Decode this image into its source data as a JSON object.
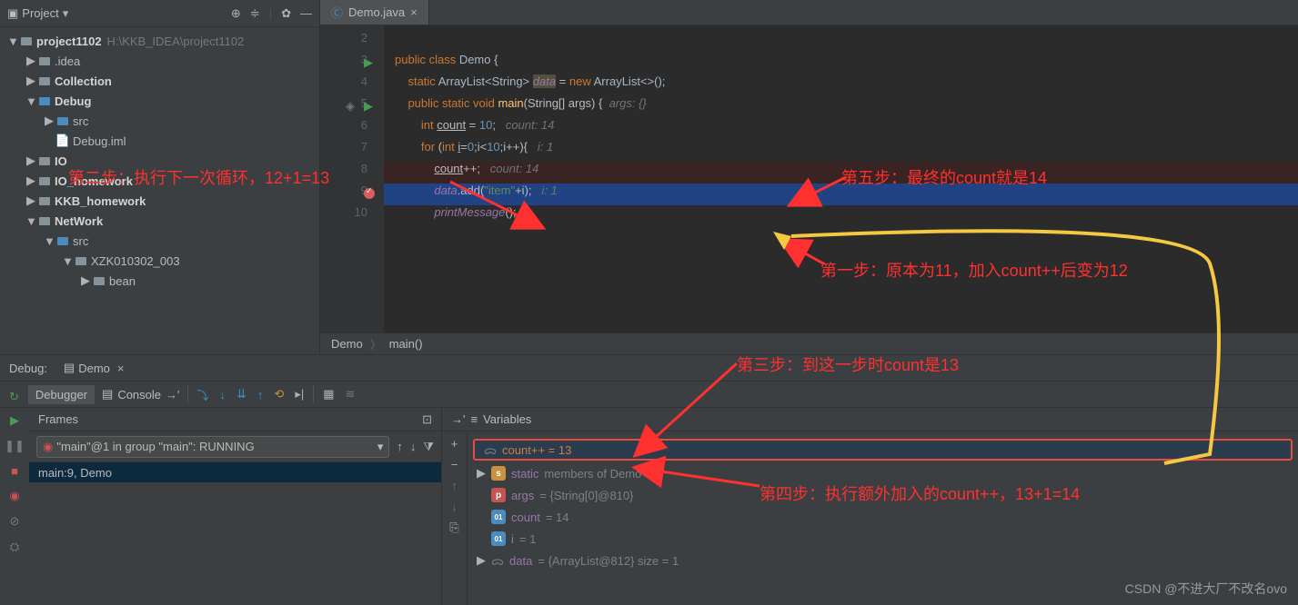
{
  "project": {
    "title": "Project",
    "root": "project1102",
    "root_path": "H:\\KKB_IDEA\\project1102",
    "items": [
      {
        "label": ".idea",
        "indent": 28,
        "arrow": "▶"
      },
      {
        "label": "Collection",
        "indent": 28,
        "arrow": "▶",
        "bold": true
      },
      {
        "label": "Debug",
        "indent": 28,
        "arrow": "▼",
        "bold": true,
        "blue": true
      },
      {
        "label": "src",
        "indent": 48,
        "arrow": "▶",
        "blue": true
      },
      {
        "label": "Debug.iml",
        "indent": 48,
        "arrow": "",
        "file": true
      },
      {
        "label": "IO",
        "indent": 28,
        "arrow": "▶",
        "bold": true
      },
      {
        "label": "IO_homework",
        "indent": 28,
        "arrow": "▶",
        "bold": true
      },
      {
        "label": "KKB_homework",
        "indent": 28,
        "arrow": "▶",
        "bold": true
      },
      {
        "label": "NetWork",
        "indent": 28,
        "arrow": "▼",
        "bold": true
      },
      {
        "label": "src",
        "indent": 48,
        "arrow": "▼",
        "blue": true
      },
      {
        "label": "XZK010302_003",
        "indent": 68,
        "arrow": "▼"
      },
      {
        "label": "bean",
        "indent": 88,
        "arrow": "▶"
      }
    ]
  },
  "editor": {
    "tab_name": "Demo.java",
    "lines": [
      {
        "n": "2"
      },
      {
        "n": "3"
      },
      {
        "n": "4"
      },
      {
        "n": "5"
      },
      {
        "n": "6"
      },
      {
        "n": "7"
      },
      {
        "n": "8"
      },
      {
        "n": "9"
      },
      {
        "n": "10"
      }
    ],
    "breadcrumb": {
      "class": "Demo",
      "method": "main()"
    }
  },
  "code": {
    "l3_1": "public class ",
    "l3_2": "Demo ",
    "l3_3": "{",
    "l4_1": "static ",
    "l4_2": "ArrayList<String> ",
    "l4_3": "data",
    "l4_4": " = ",
    "l4_5": "new ",
    "l4_6": "ArrayList<>();",
    "l5_1": "public static void ",
    "l5_2": "main",
    "l5_3": "(String[] args) {  ",
    "l5_4": "args: {}",
    "l6_1": "int ",
    "l6_2": "count",
    "l6_3": " = ",
    "l6_4": "10",
    "l6_5": ";   ",
    "l6_6": "count: 14",
    "l7_1": "for ",
    "l7_2": "(",
    "l7_3": "int ",
    "l7_4": "i",
    "l7_5": "=",
    "l7_6": "0",
    "l7_7": ";i<",
    "l7_8": "10",
    "l7_9": ";i++){   ",
    "l7_10": "i: 1",
    "l8_1": "count",
    "l8_2": "++;   ",
    "l8_3": "count: 14",
    "l9_1": "data",
    "l9_2": ".add(",
    "l9_3": "\"item\"",
    "l9_4": "+i);   ",
    "l9_5": "i: 1",
    "l10_1": "printMessage",
    "l10_2": "();"
  },
  "debug": {
    "title": "Debug:",
    "tab": "Demo",
    "debugger_tab": "Debugger",
    "console_tab": "Console",
    "frames_title": "Frames",
    "vars_title": "Variables",
    "thread": "\"main\"@1 in group \"main\": RUNNING",
    "frame": "main:9, Demo",
    "watch": "count++ = 13",
    "vars": [
      {
        "type": "s",
        "name": "static",
        "val": " members of Demo"
      },
      {
        "type": "p",
        "name": "args",
        "val": " = {String[0]@810}"
      },
      {
        "type": "oi",
        "name": "count",
        "val": " = 14"
      },
      {
        "type": "oi",
        "name": "i",
        "val": " = 1"
      },
      {
        "type": "oo",
        "name": "data",
        "val": " = {ArrayList@812}  size = 1"
      }
    ]
  },
  "annotations": {
    "a1": "第二步：执行下一次循环，12+1=13",
    "a2": "第五步：最终的count就是14",
    "a3": "第一步：原本为11，加入count++后变为12",
    "a4": "第三步：到这一步时count是13",
    "a5": "第四步：执行额外加入的count++，13+1=14"
  },
  "watermark": "CSDN @不进大厂不改名ovo"
}
